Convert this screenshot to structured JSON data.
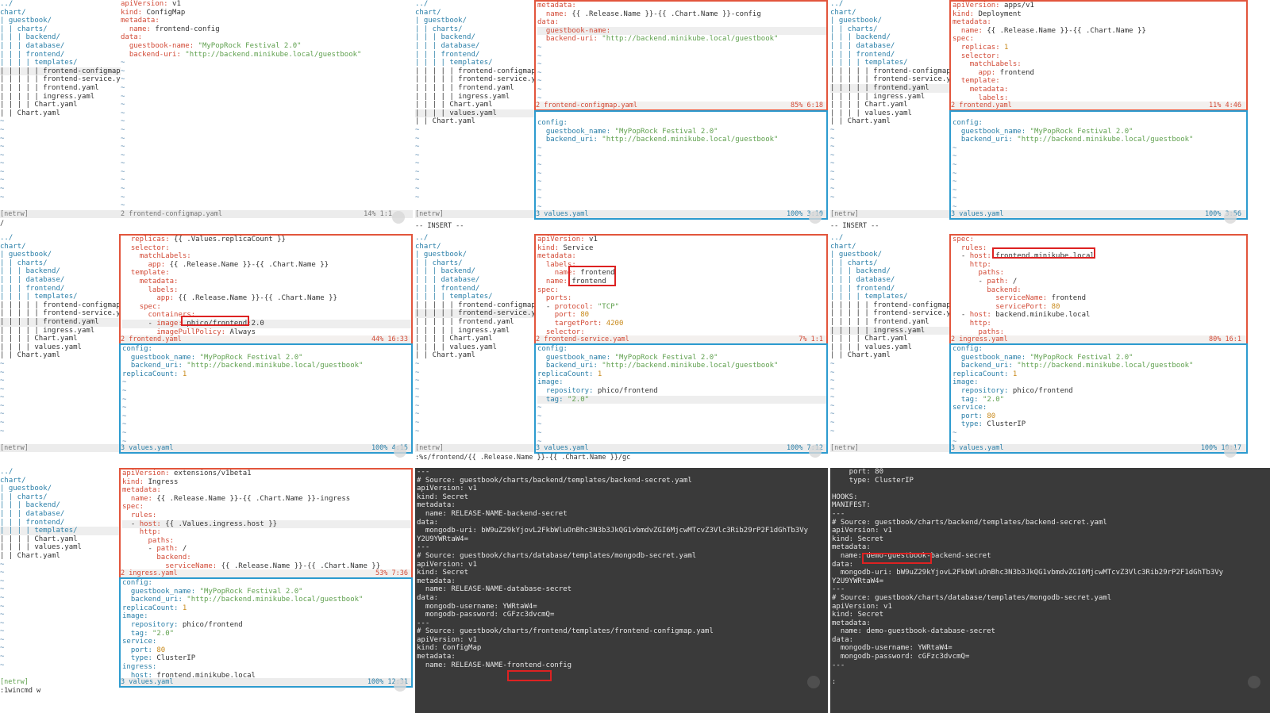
{
  "tree_a": [
    "../",
    "chart/",
    "| guestbook/",
    "| | charts/",
    "| | | backend/",
    "| | | database/",
    "| | | frontend/",
    "| | | | templates/",
    "| | | | | frontend-configmap",
    "| | | | | frontend-service.y",
    "| | | | | frontend.yaml",
    "| | | | | ingress.yaml",
    "| | | | Chart.yaml",
    "| | Chart.yaml"
  ],
  "tree_b": [
    "../",
    "chart/",
    "| guestbook/",
    "| | charts/",
    "| | | backend/",
    "| | | database/",
    "| | | frontend/",
    "| | | | templates/",
    "| | | | | frontend-configmap",
    "| | | | | frontend-service.y",
    "| | | | | frontend.yaml",
    "| | | | | ingress.yaml",
    "| | | | Chart.yaml",
    "| | | | values.yaml",
    "| | Chart.yaml"
  ],
  "tree_c": [
    "../",
    "chart/",
    "| guestbook/",
    "| | charts/",
    "| | | backend/",
    "| | | database/",
    "| | | frontend/",
    "| | | | templates/",
    "| | | | Chart.yaml",
    "| | | | values.yaml",
    "| | Chart.yaml"
  ],
  "netrw_label": "[netrw]",
  "insert_label": "-- INSERT --",
  "values_status": "3 values.yaml",
  "p1": {
    "lines": [
      "apiVersion: v1",
      "kind: ConfigMap",
      "metadata:",
      "  name: frontend-config",
      "data:",
      "  guestbook-name: \"MyPopRock Festival 2.0\"",
      "  backend-uri: \"http://backend.minikube.local/guestbook\""
    ],
    "status": "2 frontend-configmap.yaml",
    "pos": "14% 1:1",
    "cmd": "/"
  },
  "p2": {
    "top": [
      "metadata:",
      "  name: {{ .Release.Name }}-{{ .Chart.Name }}-config",
      "data:",
      "  guestbook-name:",
      "  backend-uri: \"http://backend.minikube.local/guestbook\""
    ],
    "top_status": "2 frontend-configmap.yaml",
    "top_pos": "85% 6:18",
    "bottom": [
      "config:",
      "  guestbook_name: \"MyPopRock Festival 2.0\"",
      "  backend_uri: \"http://backend.minikube.local/guestbook\""
    ],
    "bottom_pos": "100% 3:10"
  },
  "p3": {
    "top": [
      "apiVersion: apps/v1",
      "kind: Deployment",
      "metadata:",
      "  name: {{ .Release.Name }}-{{ .Chart.Name }}",
      "spec:",
      "  replicas: 1",
      "  selector:",
      "    matchLabels:",
      "      app: frontend",
      "  template:",
      "    metadata:",
      "      labels:"
    ],
    "top_status": "2 frontend.yaml",
    "top_pos": "11% 4:46",
    "bottom": [
      "config:",
      "  guestbook_name: \"MyPopRock Festival 2.0\"",
      "  backend_uri: \"http://backend.minikube.local/guestbook\""
    ],
    "bottom_pos": "100% 3:56"
  },
  "p4": {
    "top": [
      "  replicas: {{ .Values.replicaCount }}",
      "  selector:",
      "    matchLabels:",
      "      app: {{ .Release.Name }}-{{ .Chart.Name }}",
      "  template:",
      "    metadata:",
      "      labels:",
      "        app: {{ .Release.Name }}-{{ .Chart.Name }}",
      "    spec:",
      "      containers:",
      "      - image: phico/frontend:2.0",
      "        imagePullPolicy: Always"
    ],
    "top_status": "2 frontend.yaml",
    "top_pos": "44% 16:33",
    "bottom": [
      "config:",
      "  guestbook_name: \"MyPopRock Festival 2.0\"",
      "  backend_uri: \"http://backend.minikube.local/guestbook\"",
      "replicaCount: 1"
    ],
    "bottom_pos": "100% 4:15"
  },
  "p5": {
    "top": [
      "apiVersion: v1",
      "kind: Service",
      "metadata:",
      "  labels:",
      "    name: frontend",
      "  name: frontend",
      "spec:",
      "  ports:",
      "  - protocol: \"TCP\"",
      "    port: 80",
      "    targetPort: 4200",
      "  selector:"
    ],
    "top_status": "2 frontend-service.yaml",
    "top_pos": "7% 1:1",
    "bottom": [
      "config:",
      "  guestbook_name: \"MyPopRock Festival 2.0\"",
      "  backend_uri: \"http://backend.minikube.local/guestbook\"",
      "replicaCount: 1",
      "image:",
      "  repository: phico/frontend",
      "  tag: \"2.0\""
    ],
    "bottom_pos": "100% 7:12",
    "cmd": ":%s/frontend/{{ .Release.Name }}-{{ .Chart.Name }}/gc"
  },
  "p6": {
    "top": [
      "spec:",
      "  rules:",
      "  - host: frontend.minikube.local",
      "    http:",
      "      paths:",
      "      - path: /",
      "        backend:",
      "          serviceName: frontend",
      "          servicePort: 80",
      "  - host: backend.minikube.local",
      "    http:",
      "      paths:"
    ],
    "top_status": "2 ingress.yaml",
    "top_pos": "80% 16:1",
    "bottom": [
      "config:",
      "  guestbook_name: \"MyPopRock Festival 2.0\"",
      "  backend_uri: \"http://backend.minikube.local/guestbook\"",
      "replicaCount: 1",
      "image:",
      "  repository: phico/frontend",
      "  tag: \"2.0\"",
      "service:",
      "  port: 80",
      "  type: ClusterIP"
    ],
    "bottom_pos": "100% 10:17"
  },
  "p7": {
    "top": [
      "apiVersion: extensions/v1beta1",
      "kind: Ingress",
      "metadata:",
      "  name: {{ .Release.Name }}-{{ .Chart.Name }}-ingress",
      "spec:",
      "  rules:",
      "  - host: {{ .Values.ingress.host }}",
      "    http:",
      "      paths:",
      "      - path: /",
      "        backend:",
      "          serviceName: {{ .Release.Name }}-{{ .Chart.Name }}"
    ],
    "top_status": "2 ingress.yaml",
    "top_pos": "53% 7:36",
    "bottom": [
      "config:",
      "  guestbook_name: \"MyPopRock Festival 2.0\"",
      "  backend_uri: \"http://backend.minikube.local/guestbook\"",
      "replicaCount: 1",
      "image:",
      "  repository: phico/frontend",
      "  tag: \"2.0\"",
      "service:",
      "  port: 80",
      "  type: ClusterIP",
      "ingress:",
      "  host: frontend.minikube.local"
    ],
    "bottom_pos": "100% 12:31",
    "cmd": ":1wincmd w"
  },
  "p8": {
    "lines": [
      "---",
      "# Source: guestbook/charts/backend/templates/backend-secret.yaml",
      "apiVersion: v1",
      "kind: Secret",
      "metadata:",
      "  name: RELEASE-NAME-backend-secret",
      "data:",
      "  mongodb-uri: bW9uZ29kYjovL2FkbWluOnBhc3N3b3JkQG1vbmdvZGI6MjcwMTcvZ3Vlc3Rib29rP2F1dGhTb3Vy",
      "Y2U9YWRtaW4=",
      "---",
      "# Source: guestbook/charts/database/templates/mongodb-secret.yaml",
      "apiVersion: v1",
      "kind: Secret",
      "metadata:",
      "  name: RELEASE-NAME-database-secret",
      "data:",
      "  mongodb-username: YWRtaW4=",
      "  mongodb-password: cGFzc3dvcmQ=",
      "---",
      "# Source: guestbook/charts/frontend/templates/frontend-configmap.yaml",
      "apiVersion: v1",
      "kind: ConfigMap",
      "metadata:",
      "  name: RELEASE-NAME-frontend-config"
    ]
  },
  "p9": {
    "lines": [
      "    port: 80",
      "    type: ClusterIP",
      "",
      "HOOKS:",
      "MANIFEST:",
      "---",
      "# Source: guestbook/charts/backend/templates/backend-secret.yaml",
      "apiVersion: v1",
      "kind: Secret",
      "metadata:",
      "  name: demo-guestbook-backend-secret",
      "data:",
      "  mongodb-uri: bW9uZ29kYjovL2FkbWluOnBhc3N3b3JkQG1vbmdvZGI6MjcwMTcvZ3Vlc3Rib29rP2F1dGhTb3Vy",
      "Y2U9YWRtaW4=",
      "---",
      "# Source: guestbook/charts/database/templates/mongodb-secret.yaml",
      "apiVersion: v1",
      "kind: Secret",
      "metadata:",
      "  name: demo-guestbook-database-secret",
      "data:",
      "  mongodb-username: YWRtaW4=",
      "  mongodb-password: cGFzc3dvcmQ=",
      "---"
    ],
    "cmd": ":"
  }
}
